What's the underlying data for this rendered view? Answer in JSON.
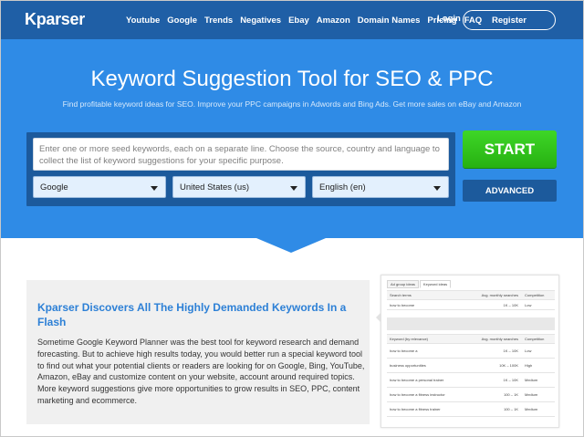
{
  "nav": {
    "logo": "Kparser",
    "links": [
      "Youtube",
      "Google",
      "Trends",
      "Negatives",
      "Ebay",
      "Amazon",
      "Domain Names",
      "Pricing",
      "FAQ"
    ],
    "login": "Login",
    "register": "Register"
  },
  "hero": {
    "title": "Keyword Suggestion Tool for SEO & PPC",
    "subtitle": "Find profitable keyword ideas for SEO. Improve your PPC campaigns in Adwords and Bing Ads. Get more sales on eBay and Amazon",
    "input_placeholder": "Enter one or more seed keywords, each on a separate line. Choose the source, country and language to collect the list of keyword suggestions for your specific purpose.",
    "source": "Google",
    "country": "United States (us)",
    "language": "English (en)",
    "start": "START",
    "advanced": "ADVANCED"
  },
  "feature": {
    "title": "Kparser Discovers All The Highly Demanded Keywords In a Flash",
    "text": "Sometime Google Keyword Planner was the best tool for keyword research and demand forecasting. But to achieve high results today, you would better run a special keyword tool to find out what your potential clients or readers are looking for on Google, Bing, YouTube, Amazon, eBay and customize content on your website, account around required topics. More keyword suggestions give more opportunities to grow results in SEO, PPC, content marketing and ecommerce."
  },
  "screenshot": {
    "tabs": [
      "Ad group ideas",
      "Keyword ideas"
    ],
    "table1": {
      "headers": [
        "Search terms",
        "Avg. monthly searches",
        "Competition"
      ],
      "rows": [
        [
          "how to become",
          "1K – 10K",
          "Low"
        ]
      ]
    },
    "table2": {
      "headers": [
        "Keyword (by relevance)",
        "Avg. monthly searches",
        "Competition"
      ],
      "rows": [
        [
          "how to become a",
          "1K – 10K",
          "Low"
        ],
        [
          "business opportunities",
          "10K – 100K",
          "High"
        ],
        [
          "how to become a personal trainer",
          "1K – 10K",
          "Medium"
        ],
        [
          "how to become a fitness instructor",
          "100 – 1K",
          "Medium"
        ],
        [
          "how to become a fitness trainer",
          "100 – 1K",
          "Medium"
        ]
      ]
    }
  }
}
